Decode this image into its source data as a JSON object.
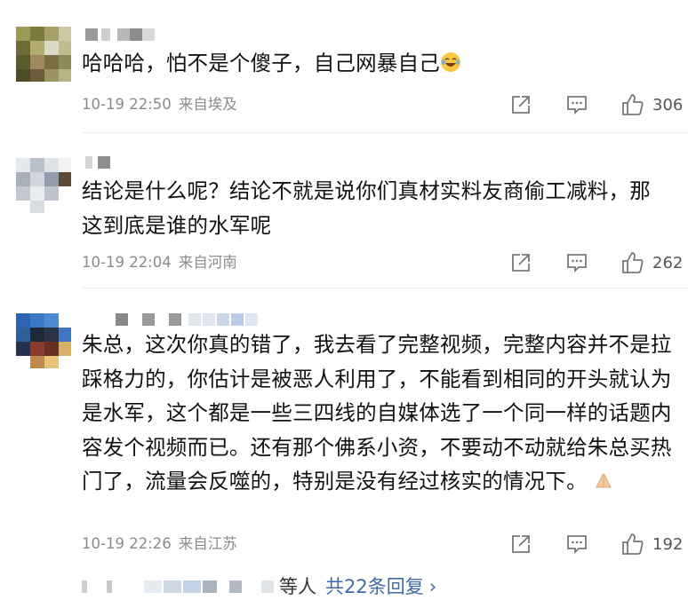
{
  "comments": [
    {
      "text": "哈哈哈，怕不是个傻子，自己网暴自己",
      "emoji": "laughing-tears-emoji",
      "time": "10-19 22:50",
      "location": "来自埃及",
      "likes": "306"
    },
    {
      "text": "结论是什么呢？结论不就是说你们真材实料友商偷工减料，那这到底是谁的水军呢",
      "time": "10-19 22:04",
      "location": "来自河南",
      "likes": "262"
    },
    {
      "text": "朱总，这次你真的错了，我去看了完整视频，完整内容并不是拉踩格力的，你估计是被恶人利用了，不能看到相同的开头就认为是水军，这个都是一些三四线的自媒体选了一个同一样的话题内容发个视频而已。还有那个佛系小资，不要动不动就给朱总买热门了，流量会反噬的，特别是没有经过核实的情况下。",
      "emoji": "praying-hands-emoji",
      "time": "10-19 22:26",
      "location": "来自江苏",
      "likes": "192"
    }
  ],
  "footer": {
    "suffix": "等人",
    "reply_link": "共22条回复",
    "chevron": "›"
  },
  "icons": {
    "share": "share-icon",
    "comment": "comment-icon",
    "like": "thumbs-up-icon"
  },
  "colors": {
    "link": "#3f6aa8",
    "meta": "#8a8a8a"
  }
}
